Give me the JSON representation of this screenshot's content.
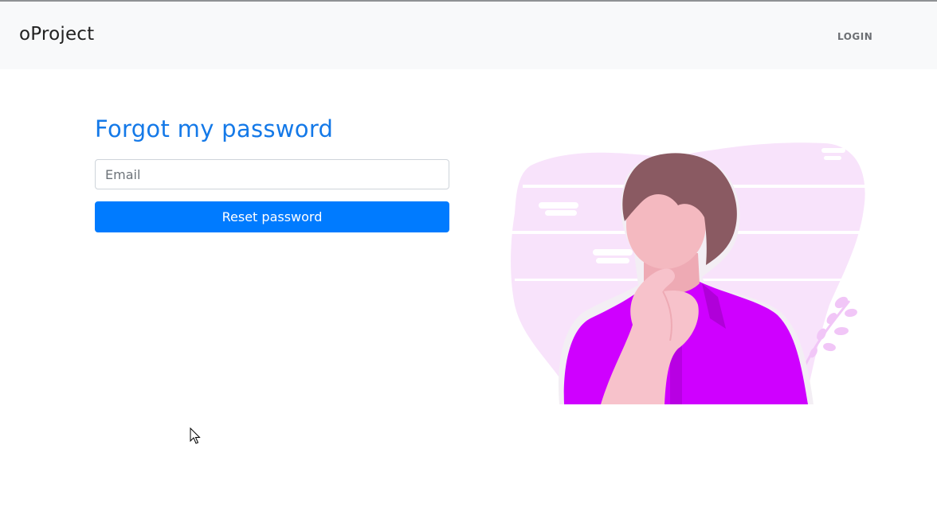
{
  "navbar": {
    "brand": "oProject",
    "login_label": "LOGIN"
  },
  "form": {
    "title": "Forgot my password",
    "email_placeholder": "Email",
    "email_value": "",
    "reset_label": "Reset password"
  },
  "colors": {
    "accent": "#007bff",
    "title": "#1479e8",
    "navbar_bg": "#f8f9fa",
    "shirt": "#cf00ff",
    "hair": "#8a5a62",
    "skin": "#f4b9c0",
    "blob": "#f8e3fb"
  },
  "icons": {
    "illustration": "thinking-person-illustration",
    "cursor": "mouse-cursor-icon"
  }
}
